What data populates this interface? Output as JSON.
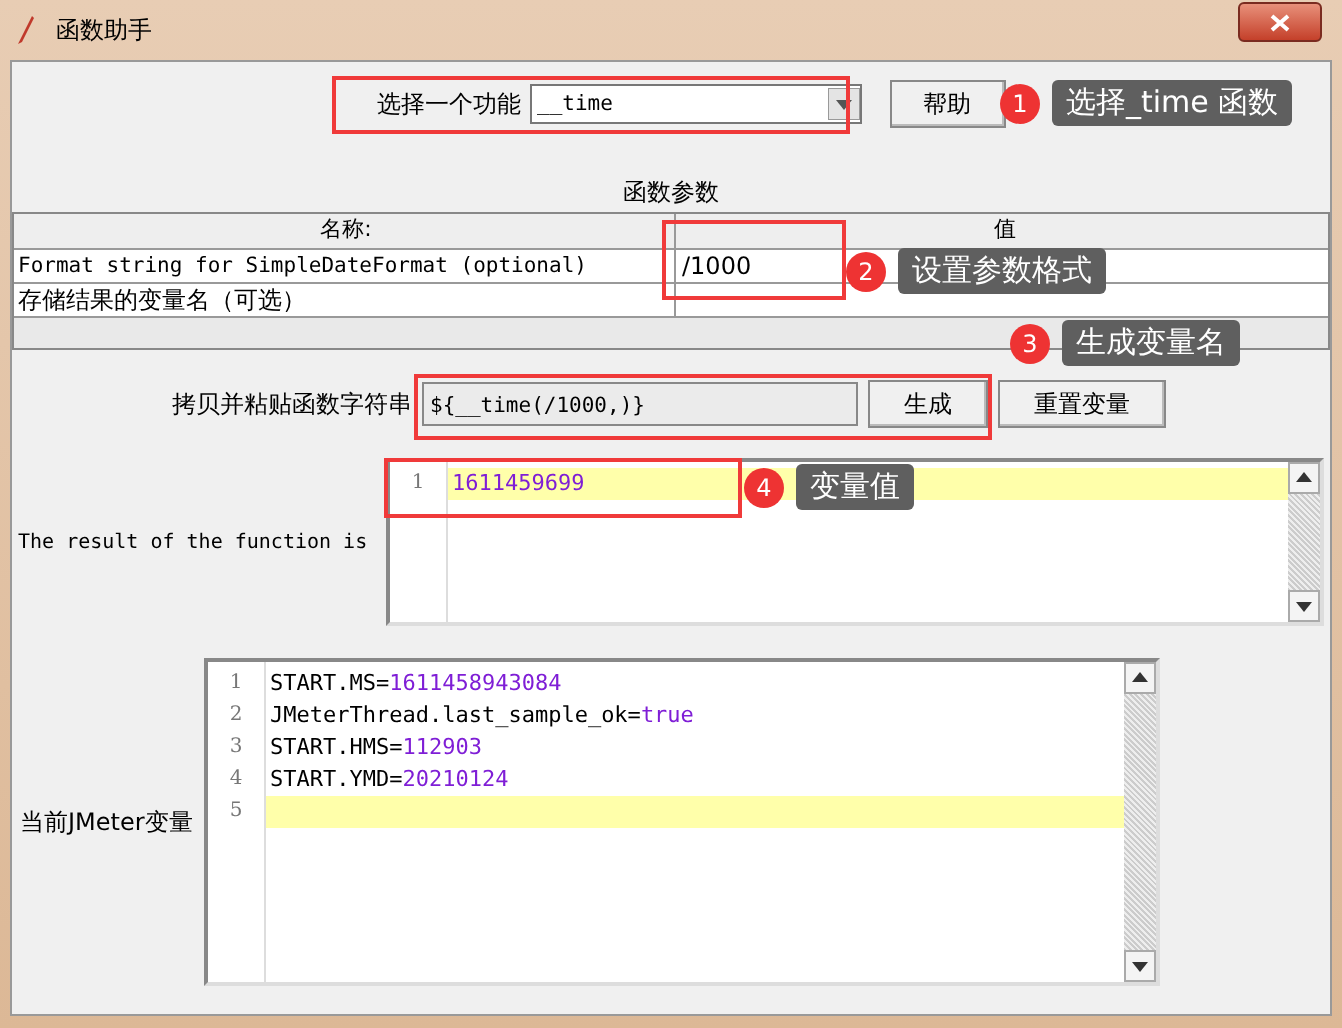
{
  "window": {
    "title": "函数助手"
  },
  "function_select": {
    "label": "选择一个功能",
    "value": "__time",
    "help_button": "帮助"
  },
  "parameters": {
    "title": "函数参数",
    "columns": [
      "名称:",
      "值"
    ],
    "rows": [
      {
        "name": "Format string for SimpleDateFormat (optional)",
        "value": "/1000"
      },
      {
        "name": "存储结果的变量名（可选）",
        "value": ""
      }
    ]
  },
  "function_string": {
    "label": "拷贝并粘贴函数字符串",
    "value": "${__time(/1000,)}",
    "buttons": [
      "生成",
      "重置变量"
    ]
  },
  "result": {
    "label": "The result of the function is",
    "lines": [
      {
        "number": "1",
        "parts": [
          {
            "text": "1611459699",
            "kind": "value"
          }
        ],
        "current": true
      }
    ]
  },
  "variables": {
    "label": "当前JMeter变量",
    "lines": [
      {
        "number": "1",
        "parts": [
          {
            "text": "START.MS=",
            "kind": "key"
          },
          {
            "text": "1611458943084",
            "kind": "value"
          }
        ],
        "current": false
      },
      {
        "number": "2",
        "parts": [
          {
            "text": "JMeterThread.last_sample_ok=",
            "kind": "key"
          },
          {
            "text": "true",
            "kind": "value"
          }
        ],
        "current": false
      },
      {
        "number": "3",
        "parts": [
          {
            "text": "START.HMS=",
            "kind": "key"
          },
          {
            "text": "112903",
            "kind": "value"
          }
        ],
        "current": false
      },
      {
        "number": "4",
        "parts": [
          {
            "text": "START.YMD=",
            "kind": "key"
          },
          {
            "text": "20210124",
            "kind": "value"
          }
        ],
        "current": false
      },
      {
        "number": "5",
        "current": true
      }
    ]
  },
  "annotations": [
    {
      "number": "1",
      "text": "选择_time 函数"
    },
    {
      "number": "2",
      "text": "设置参数格式"
    },
    {
      "number": "3",
      "text": "生成变量名"
    },
    {
      "number": "4",
      "text": "变量值"
    }
  ]
}
